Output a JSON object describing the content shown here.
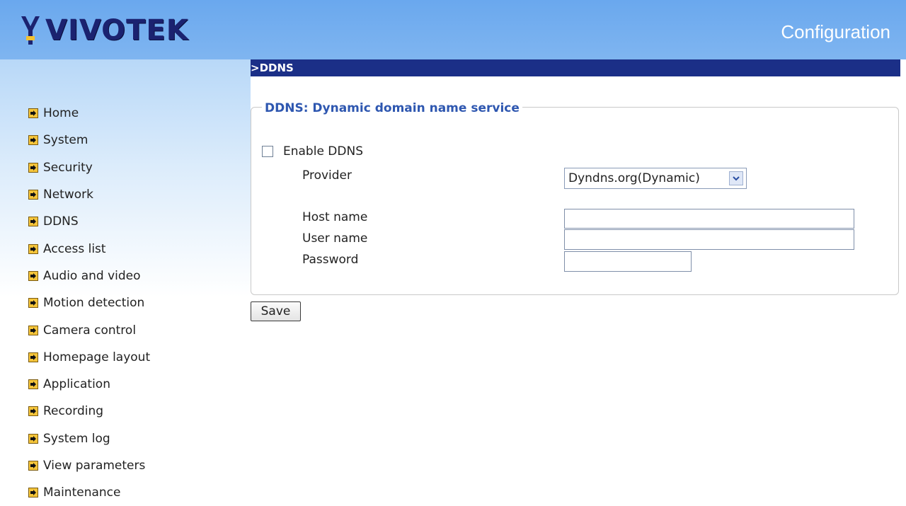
{
  "header": {
    "logo_text": "VIVOTEK",
    "right_title": "Configuration"
  },
  "sidebar": {
    "items": [
      {
        "label": "Home"
      },
      {
        "label": "System"
      },
      {
        "label": "Security"
      },
      {
        "label": "Network"
      },
      {
        "label": "DDNS"
      },
      {
        "label": "Access list"
      },
      {
        "label": "Audio and video"
      },
      {
        "label": "Motion detection"
      },
      {
        "label": "Camera control"
      },
      {
        "label": "Homepage layout"
      },
      {
        "label": "Application"
      },
      {
        "label": "Recording"
      },
      {
        "label": "System log"
      },
      {
        "label": "View parameters"
      },
      {
        "label": "Maintenance"
      }
    ]
  },
  "page": {
    "title": ">DDNS",
    "panel_title": "DDNS: Dynamic domain name service",
    "enable_label": "Enable DDNS",
    "provider_label": "Provider",
    "provider_value": "Dyndns.org(Dynamic)",
    "host_label": "Host name",
    "host_value": "",
    "user_label": "User name",
    "user_value": "",
    "password_label": "Password",
    "password_value": "",
    "save_label": "Save"
  },
  "colors": {
    "header_bg": "#6aa8ee",
    "title_bar_bg": "#1b2f87",
    "legend_text": "#2e57b0",
    "bullet": "#f4c43a"
  }
}
